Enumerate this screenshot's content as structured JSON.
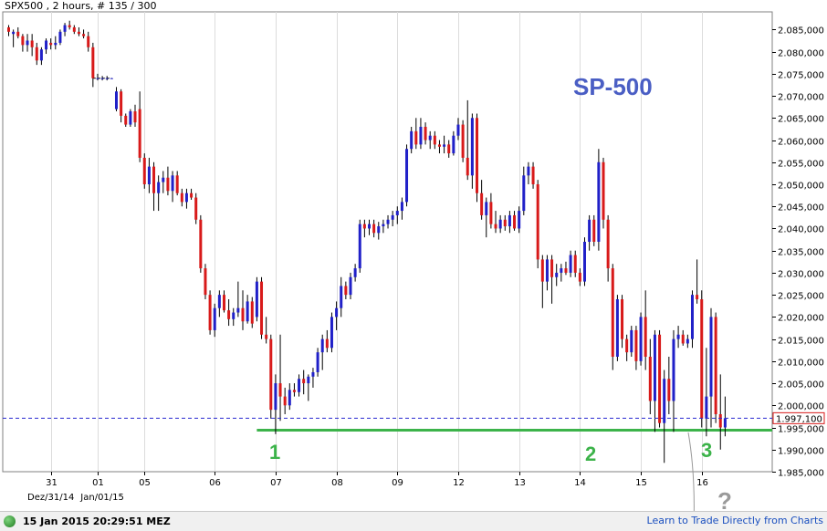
{
  "header": {
    "title": "SPX500 , 2 hours, # 135 / 300"
  },
  "annotations": {
    "title": "SP-500",
    "marker_1": "1",
    "marker_2": "2",
    "marker_3": "3",
    "question": "?"
  },
  "status": {
    "timestamp": "15 Jan 2015 20:29:51 MEZ",
    "link": "Learn to Trade Directly from Charts"
  },
  "colors": {
    "up": "#2020c8",
    "down": "#d81a1a",
    "support": "#3cb34a",
    "title": "#4a5ec4"
  },
  "chart_data": {
    "type": "candlestick",
    "y_axis": {
      "min": 1985.0,
      "max": 2089.0,
      "ticks": [
        "2.085,000",
        "2.080,000",
        "2.075,000",
        "2.070,000",
        "2.065,000",
        "2.060,000",
        "2.055,000",
        "2.050,000",
        "2.045,000",
        "2.040,000",
        "2.035,000",
        "2.030,000",
        "2.025,000",
        "2.020,000",
        "2.015,000",
        "2.010,000",
        "2.005,000",
        "2.000,000",
        "1.995,000",
        "1.990,000",
        "1.985,000"
      ],
      "tick_values": [
        2085,
        2080,
        2075,
        2070,
        2065,
        2060,
        2055,
        2050,
        2045,
        2040,
        2035,
        2030,
        2025,
        2020,
        2015,
        2010,
        2005,
        2000,
        1995,
        1990,
        1985
      ]
    },
    "x_ticks": [
      {
        "label": "31",
        "bar": 9
      },
      {
        "label": "01",
        "bar": 19
      },
      {
        "label": "05",
        "bar": 29
      },
      {
        "label": "06",
        "bar": 44
      },
      {
        "label": "07",
        "bar": 57
      },
      {
        "label": "08",
        "bar": 70
      },
      {
        "label": "09",
        "bar": 83
      },
      {
        "label": "12",
        "bar": 96
      },
      {
        "label": "13",
        "bar": 109
      },
      {
        "label": "14",
        "bar": 122
      },
      {
        "label": "15",
        "bar": 135
      },
      {
        "label": "16",
        "bar": 148
      }
    ],
    "x_sub_labels": [
      {
        "label": "Dez/31/14",
        "bar": 9
      },
      {
        "label": "Jan/01/15",
        "bar": 20
      }
    ],
    "current_price": {
      "label": "1.997,100",
      "value": 1997.1
    },
    "support_level": 1994.4,
    "horizontal_segments": [
      {
        "value": 2074.0,
        "from_bar": 18,
        "to_bar": 22
      }
    ],
    "candles": [
      {
        "o": 2085.5,
        "h": 2086.0,
        "l": 2083.5,
        "c": 2084.5
      },
      {
        "o": 2084.0,
        "h": 2085.0,
        "l": 2081.0,
        "c": 2084.5
      },
      {
        "o": 2084.5,
        "h": 2085.5,
        "l": 2083.0,
        "c": 2083.5
      },
      {
        "o": 2083.5,
        "h": 2084.0,
        "l": 2080.0,
        "c": 2081.5
      },
      {
        "o": 2081.5,
        "h": 2084.0,
        "l": 2080.0,
        "c": 2082.5
      },
      {
        "o": 2082.5,
        "h": 2084.0,
        "l": 2079.0,
        "c": 2081.0
      },
      {
        "o": 2081.0,
        "h": 2082.0,
        "l": 2077.0,
        "c": 2078.0
      },
      {
        "o": 2078.0,
        "h": 2081.0,
        "l": 2077.0,
        "c": 2080.5
      },
      {
        "o": 2080.5,
        "h": 2083.0,
        "l": 2079.5,
        "c": 2082.5
      },
      {
        "o": 2082.0,
        "h": 2083.0,
        "l": 2080.5,
        "c": 2081.5
      },
      {
        "o": 2081.5,
        "h": 2083.5,
        "l": 2080.5,
        "c": 2082.0
      },
      {
        "o": 2082.0,
        "h": 2085.0,
        "l": 2081.5,
        "c": 2084.5
      },
      {
        "o": 2084.5,
        "h": 2086.5,
        "l": 2083.5,
        "c": 2086.0
      },
      {
        "o": 2086.0,
        "h": 2087.0,
        "l": 2085.0,
        "c": 2085.5
      },
      {
        "o": 2085.5,
        "h": 2086.0,
        "l": 2084.0,
        "c": 2084.5
      },
      {
        "o": 2084.5,
        "h": 2085.5,
        "l": 2083.5,
        "c": 2084.0
      },
      {
        "o": 2084.0,
        "h": 2085.0,
        "l": 2083.0,
        "c": 2083.5
      },
      {
        "o": 2083.5,
        "h": 2084.5,
        "l": 2080.0,
        "c": 2081.0
      },
      {
        "o": 2081.0,
        "h": 2082.0,
        "l": 2072.0,
        "c": 2074.0
      },
      {
        "o": 2074.0,
        "h": 2075.0,
        "l": 2073.5,
        "c": 2074.0
      },
      {
        "o": 2074.0,
        "h": 2074.5,
        "l": 2073.5,
        "c": 2074.0
      },
      {
        "o": 2074.0,
        "h": 2074.5,
        "l": 2073.5,
        "c": 2074.0
      },
      {
        "o": 2074.0,
        "h": 2074.0,
        "l": 2074.0,
        "c": 2074.0
      },
      {
        "o": 2067.0,
        "h": 2072.0,
        "l": 2066.5,
        "c": 2071.0
      },
      {
        "o": 2071.0,
        "h": 2071.5,
        "l": 2064.0,
        "c": 2065.5
      },
      {
        "o": 2065.5,
        "h": 2066.0,
        "l": 2063.0,
        "c": 2063.5
      },
      {
        "o": 2063.5,
        "h": 2067.0,
        "l": 2063.0,
        "c": 2066.5
      },
      {
        "o": 2066.5,
        "h": 2068.0,
        "l": 2063.0,
        "c": 2064.0
      },
      {
        "o": 2067.0,
        "h": 2071.0,
        "l": 2055.0,
        "c": 2056.0
      },
      {
        "o": 2056.0,
        "h": 2057.0,
        "l": 2049.0,
        "c": 2050.0
      },
      {
        "o": 2050.0,
        "h": 2056.0,
        "l": 2048.0,
        "c": 2054.0
      },
      {
        "o": 2054.0,
        "h": 2055.0,
        "l": 2044.0,
        "c": 2048.0
      },
      {
        "o": 2048.0,
        "h": 2052.0,
        "l": 2044.0,
        "c": 2050.5
      },
      {
        "o": 2050.5,
        "h": 2053.0,
        "l": 2048.0,
        "c": 2051.5
      },
      {
        "o": 2051.5,
        "h": 2054.0,
        "l": 2047.5,
        "c": 2048.5
      },
      {
        "o": 2048.5,
        "h": 2053.0,
        "l": 2046.0,
        "c": 2052.0
      },
      {
        "o": 2052.0,
        "h": 2053.0,
        "l": 2047.5,
        "c": 2048.0
      },
      {
        "o": 2048.0,
        "h": 2049.0,
        "l": 2045.0,
        "c": 2046.0
      },
      {
        "o": 2046.0,
        "h": 2049.0,
        "l": 2044.5,
        "c": 2048.0
      },
      {
        "o": 2048.0,
        "h": 2049.0,
        "l": 2046.5,
        "c": 2047.0
      },
      {
        "o": 2047.0,
        "h": 2048.0,
        "l": 2041.0,
        "c": 2042.0
      },
      {
        "o": 2042.0,
        "h": 2043.0,
        "l": 2030.0,
        "c": 2031.0
      },
      {
        "o": 2031.0,
        "h": 2032.0,
        "l": 2024.0,
        "c": 2025.0
      },
      {
        "o": 2025.0,
        "h": 2026.0,
        "l": 2016.0,
        "c": 2017.0
      },
      {
        "o": 2017.0,
        "h": 2023.0,
        "l": 2015.5,
        "c": 2022.0
      },
      {
        "o": 2022.0,
        "h": 2026.0,
        "l": 2020.0,
        "c": 2025.0
      },
      {
        "o": 2025.0,
        "h": 2026.0,
        "l": 2021.0,
        "c": 2021.5
      },
      {
        "o": 2021.5,
        "h": 2024.0,
        "l": 2018.0,
        "c": 2019.5
      },
      {
        "o": 2019.5,
        "h": 2022.0,
        "l": 2018.0,
        "c": 2021.0
      },
      {
        "o": 2021.0,
        "h": 2028.0,
        "l": 2020.0,
        "c": 2022.0
      },
      {
        "o": 2022.0,
        "h": 2026.0,
        "l": 2017.0,
        "c": 2019.0
      },
      {
        "o": 2019.0,
        "h": 2025.0,
        "l": 2018.5,
        "c": 2023.5
      },
      {
        "o": 2023.5,
        "h": 2024.5,
        "l": 2017.5,
        "c": 2018.5
      },
      {
        "o": 2020.0,
        "h": 2029.0,
        "l": 2019.0,
        "c": 2028.0
      },
      {
        "o": 2028.0,
        "h": 2029.0,
        "l": 2015.0,
        "c": 2016.0
      },
      {
        "o": 2016.0,
        "h": 2020.0,
        "l": 2014.0,
        "c": 2015.0
      },
      {
        "o": 2015.0,
        "h": 2016.0,
        "l": 1997.0,
        "c": 1999.0
      },
      {
        "o": 1999.0,
        "h": 2007.0,
        "l": 1993.5,
        "c": 2005.0
      },
      {
        "o": 2005.0,
        "h": 2016.0,
        "l": 1996.5,
        "c": 2002.0
      },
      {
        "o": 2002.0,
        "h": 2004.0,
        "l": 1998.0,
        "c": 2000.0
      },
      {
        "o": 2000.0,
        "h": 2005.0,
        "l": 1999.0,
        "c": 2003.5
      },
      {
        "o": 2003.5,
        "h": 2005.0,
        "l": 2002.0,
        "c": 2003.0
      },
      {
        "o": 2003.0,
        "h": 2007.0,
        "l": 2002.0,
        "c": 2006.0
      },
      {
        "o": 2006.0,
        "h": 2008.0,
        "l": 2002.5,
        "c": 2005.0
      },
      {
        "o": 2005.0,
        "h": 2007.0,
        "l": 2001.0,
        "c": 2006.5
      },
      {
        "o": 2006.5,
        "h": 2008.5,
        "l": 2004.0,
        "c": 2007.5
      },
      {
        "o": 2007.5,
        "h": 2013.0,
        "l": 2006.5,
        "c": 2012.0
      },
      {
        "o": 2012.0,
        "h": 2016.0,
        "l": 2008.0,
        "c": 2015.0
      },
      {
        "o": 2015.0,
        "h": 2017.0,
        "l": 2012.0,
        "c": 2013.0
      },
      {
        "o": 2013.0,
        "h": 2021.0,
        "l": 2012.0,
        "c": 2020.0
      },
      {
        "o": 2020.0,
        "h": 2023.5,
        "l": 2017.0,
        "c": 2022.0
      },
      {
        "o": 2022.0,
        "h": 2029.0,
        "l": 2020.0,
        "c": 2027.0
      },
      {
        "o": 2027.0,
        "h": 2028.0,
        "l": 2024.0,
        "c": 2025.0
      },
      {
        "o": 2025.0,
        "h": 2030.0,
        "l": 2024.0,
        "c": 2029.0
      },
      {
        "o": 2029.0,
        "h": 2032.0,
        "l": 2028.0,
        "c": 2031.0
      },
      {
        "o": 2031.0,
        "h": 2042.0,
        "l": 2030.0,
        "c": 2041.0
      },
      {
        "o": 2041.0,
        "h": 2042.0,
        "l": 2038.0,
        "c": 2040.0
      },
      {
        "o": 2040.0,
        "h": 2042.0,
        "l": 2038.5,
        "c": 2041.0
      },
      {
        "o": 2041.0,
        "h": 2042.0,
        "l": 2038.0,
        "c": 2039.0
      },
      {
        "o": 2039.0,
        "h": 2041.5,
        "l": 2037.5,
        "c": 2040.5
      },
      {
        "o": 2040.5,
        "h": 2042.0,
        "l": 2039.0,
        "c": 2041.0
      },
      {
        "o": 2041.0,
        "h": 2043.0,
        "l": 2040.0,
        "c": 2042.0
      },
      {
        "o": 2042.0,
        "h": 2044.0,
        "l": 2040.5,
        "c": 2043.0
      },
      {
        "o": 2043.0,
        "h": 2045.0,
        "l": 2041.0,
        "c": 2044.0
      },
      {
        "o": 2044.0,
        "h": 2047.0,
        "l": 2042.0,
        "c": 2046.0
      },
      {
        "o": 2046.0,
        "h": 2059.0,
        "l": 2045.0,
        "c": 2058.0
      },
      {
        "o": 2058.0,
        "h": 2063.0,
        "l": 2057.0,
        "c": 2062.0
      },
      {
        "o": 2062.0,
        "h": 2065.0,
        "l": 2058.0,
        "c": 2059.0
      },
      {
        "o": 2059.0,
        "h": 2065.0,
        "l": 2058.0,
        "c": 2063.0
      },
      {
        "o": 2063.0,
        "h": 2064.0,
        "l": 2059.0,
        "c": 2060.0
      },
      {
        "o": 2060.0,
        "h": 2062.0,
        "l": 2058.0,
        "c": 2061.0
      },
      {
        "o": 2061.0,
        "h": 2062.0,
        "l": 2058.0,
        "c": 2059.0
      },
      {
        "o": 2059.0,
        "h": 2060.0,
        "l": 2057.0,
        "c": 2058.5
      },
      {
        "o": 2058.5,
        "h": 2061.0,
        "l": 2057.0,
        "c": 2059.0
      },
      {
        "o": 2059.0,
        "h": 2060.0,
        "l": 2056.0,
        "c": 2057.0
      },
      {
        "o": 2057.0,
        "h": 2062.0,
        "l": 2056.5,
        "c": 2061.0
      },
      {
        "o": 2061.0,
        "h": 2065.0,
        "l": 2060.0,
        "c": 2063.5
      },
      {
        "o": 2063.5,
        "h": 2064.5,
        "l": 2055.0,
        "c": 2056.0
      },
      {
        "o": 2056.0,
        "h": 2069.0,
        "l": 2051.0,
        "c": 2052.0
      },
      {
        "o": 2052.0,
        "h": 2066.0,
        "l": 2049.0,
        "c": 2065.0
      },
      {
        "o": 2065.0,
        "h": 2066.0,
        "l": 2046.0,
        "c": 2048.0
      },
      {
        "o": 2048.0,
        "h": 2051.0,
        "l": 2042.0,
        "c": 2043.0
      },
      {
        "o": 2043.0,
        "h": 2047.0,
        "l": 2038.0,
        "c": 2046.0
      },
      {
        "o": 2046.0,
        "h": 2048.0,
        "l": 2040.0,
        "c": 2041.0
      },
      {
        "o": 2041.0,
        "h": 2044.0,
        "l": 2039.0,
        "c": 2040.0
      },
      {
        "o": 2040.0,
        "h": 2043.0,
        "l": 2039.0,
        "c": 2042.0
      },
      {
        "o": 2042.0,
        "h": 2043.0,
        "l": 2039.5,
        "c": 2040.5
      },
      {
        "o": 2040.5,
        "h": 2044.0,
        "l": 2039.0,
        "c": 2043.0
      },
      {
        "o": 2043.0,
        "h": 2044.0,
        "l": 2039.5,
        "c": 2040.0
      },
      {
        "o": 2040.0,
        "h": 2045.0,
        "l": 2039.0,
        "c": 2044.0
      },
      {
        "o": 2044.0,
        "h": 2054.0,
        "l": 2043.0,
        "c": 2052.0
      },
      {
        "o": 2052.0,
        "h": 2055.0,
        "l": 2050.0,
        "c": 2054.0
      },
      {
        "o": 2054.0,
        "h": 2055.0,
        "l": 2049.0,
        "c": 2050.0
      },
      {
        "o": 2050.0,
        "h": 2051.0,
        "l": 2031.0,
        "c": 2033.0
      },
      {
        "o": 2033.0,
        "h": 2034.0,
        "l": 2022.0,
        "c": 2028.0
      },
      {
        "o": 2028.0,
        "h": 2034.0,
        "l": 2026.0,
        "c": 2033.0
      },
      {
        "o": 2033.0,
        "h": 2034.0,
        "l": 2023.0,
        "c": 2029.0
      },
      {
        "o": 2029.0,
        "h": 2032.0,
        "l": 2027.0,
        "c": 2030.0
      },
      {
        "o": 2030.0,
        "h": 2032.0,
        "l": 2028.0,
        "c": 2031.0
      },
      {
        "o": 2031.0,
        "h": 2032.5,
        "l": 2029.5,
        "c": 2030.0
      },
      {
        "o": 2030.0,
        "h": 2035.0,
        "l": 2029.0,
        "c": 2034.0
      },
      {
        "o": 2034.0,
        "h": 2035.0,
        "l": 2029.0,
        "c": 2030.0
      },
      {
        "o": 2030.0,
        "h": 2031.0,
        "l": 2027.0,
        "c": 2028.0
      },
      {
        "o": 2028.0,
        "h": 2038.0,
        "l": 2027.0,
        "c": 2037.0
      },
      {
        "o": 2037.0,
        "h": 2043.0,
        "l": 2035.0,
        "c": 2042.0
      },
      {
        "o": 2042.0,
        "h": 2043.0,
        "l": 2036.0,
        "c": 2037.0
      },
      {
        "o": 2037.0,
        "h": 2058.0,
        "l": 2035.0,
        "c": 2055.0
      },
      {
        "o": 2055.0,
        "h": 2056.0,
        "l": 2040.0,
        "c": 2042.0
      },
      {
        "o": 2042.0,
        "h": 2043.0,
        "l": 2028.0,
        "c": 2031.0
      },
      {
        "o": 2031.0,
        "h": 2032.0,
        "l": 2008.0,
        "c": 2011.0
      },
      {
        "o": 2011.0,
        "h": 2025.0,
        "l": 2010.0,
        "c": 2024.0
      },
      {
        "o": 2024.0,
        "h": 2025.0,
        "l": 2013.0,
        "c": 2015.0
      },
      {
        "o": 2015.0,
        "h": 2016.0,
        "l": 2010.0,
        "c": 2012.0
      },
      {
        "o": 2012.0,
        "h": 2018.0,
        "l": 2011.0,
        "c": 2017.0
      },
      {
        "o": 2017.0,
        "h": 2018.0,
        "l": 2008.0,
        "c": 2010.0
      },
      {
        "o": 2010.0,
        "h": 2021.0,
        "l": 2009.0,
        "c": 2020.0
      },
      {
        "o": 2020.0,
        "h": 2026.0,
        "l": 2008.0,
        "c": 2011.0
      },
      {
        "o": 2011.0,
        "h": 2015.0,
        "l": 1998.0,
        "c": 2001.0
      },
      {
        "o": 2001.0,
        "h": 2017.0,
        "l": 1994.0,
        "c": 2016.0
      },
      {
        "o": 2016.0,
        "h": 2017.0,
        "l": 1995.0,
        "c": 1996.0
      },
      {
        "o": 1996.0,
        "h": 2008.0,
        "l": 1987.0,
        "c": 2006.0
      },
      {
        "o": 2006.0,
        "h": 2011.0,
        "l": 1998.0,
        "c": 2001.0
      },
      {
        "o": 2001.0,
        "h": 2017.0,
        "l": 1994.0,
        "c": 2015.0
      },
      {
        "o": 2015.0,
        "h": 2018.0,
        "l": 2013.0,
        "c": 2016.0
      },
      {
        "o": 2016.0,
        "h": 2017.0,
        "l": 2013.5,
        "c": 2014.0
      },
      {
        "o": 2014.0,
        "h": 2016.0,
        "l": 2013.0,
        "c": 2015.0
      },
      {
        "o": 2015.0,
        "h": 2026.0,
        "l": 2013.0,
        "c": 2025.0
      },
      {
        "o": 2025.0,
        "h": 2033.0,
        "l": 2023.0,
        "c": 2024.0
      },
      {
        "o": 2024.0,
        "h": 2026.0,
        "l": 1995.0,
        "c": 1997.0
      },
      {
        "o": 1997.0,
        "h": 2013.0,
        "l": 1993.0,
        "c": 2002.0
      },
      {
        "o": 2002.0,
        "h": 2022.0,
        "l": 1995.0,
        "c": 2020.0
      },
      {
        "o": 2020.0,
        "h": 2021.0,
        "l": 1996.0,
        "c": 1998.0
      },
      {
        "o": 1998.0,
        "h": 2007.0,
        "l": 1990.0,
        "c": 1995.0
      },
      {
        "o": 1995.0,
        "h": 2002.0,
        "l": 1993.0,
        "c": 1997.1
      }
    ]
  }
}
